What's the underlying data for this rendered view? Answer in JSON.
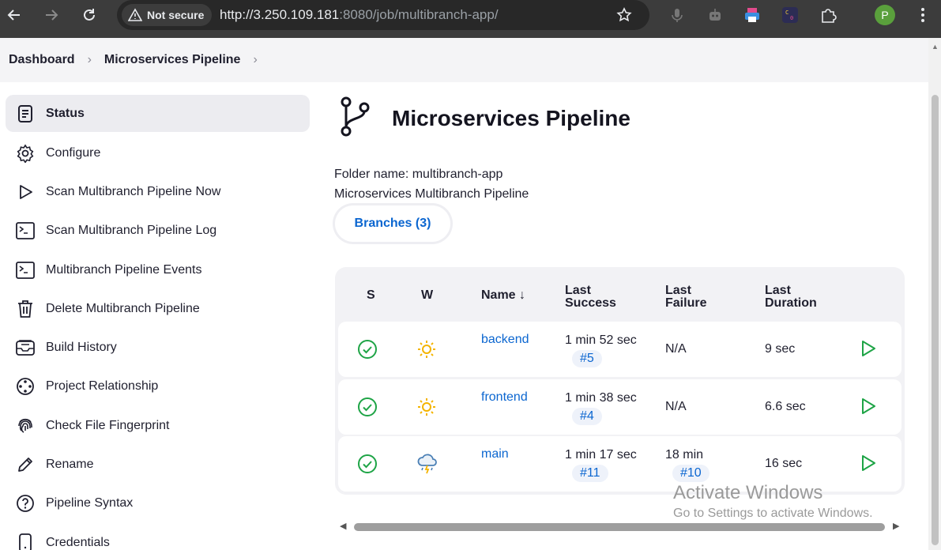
{
  "browser": {
    "security_label": "Not secure",
    "url_host": "http://3.250.109.181",
    "url_rest": ":8080/job/multibranch-app/",
    "profile_initial": "P"
  },
  "breadcrumb": {
    "items": [
      "Dashboard",
      "Microservices Pipeline"
    ]
  },
  "sidebar": {
    "items": [
      {
        "label": "Status",
        "icon": "document-icon"
      },
      {
        "label": "Configure",
        "icon": "gear-icon"
      },
      {
        "label": "Scan Multibranch Pipeline Now",
        "icon": "play-icon"
      },
      {
        "label": "Scan Multibranch Pipeline Log",
        "icon": "terminal-icon"
      },
      {
        "label": "Multibranch Pipeline Events",
        "icon": "terminal-icon"
      },
      {
        "label": "Delete Multibranch Pipeline",
        "icon": "trash-icon"
      },
      {
        "label": "Build History",
        "icon": "inbox-icon"
      },
      {
        "label": "Project Relationship",
        "icon": "relationship-icon"
      },
      {
        "label": "Check File Fingerprint",
        "icon": "fingerprint-icon"
      },
      {
        "label": "Rename",
        "icon": "pencil-icon"
      },
      {
        "label": "Pipeline Syntax",
        "icon": "help-icon"
      },
      {
        "label": "Credentials",
        "icon": "phone-icon"
      }
    ]
  },
  "main": {
    "title": "Microservices Pipeline",
    "folder_name": "Folder name: multibranch-app",
    "description": "Microservices Multibranch Pipeline",
    "tab_label": "Branches (3)"
  },
  "table": {
    "headers": {
      "s": "S",
      "w": "W",
      "name": "Name ↓",
      "last_success_1": "Last",
      "last_success_2": "Success",
      "last_failure_1": "Last",
      "last_failure_2": "Failure",
      "last_duration_1": "Last",
      "last_duration_2": "Duration"
    },
    "rows": [
      {
        "name": "backend",
        "weather": "sunny-icon",
        "last_success": "1 min 52 sec",
        "success_build": "#5",
        "last_failure": "N/A",
        "failure_build": "",
        "duration": "9 sec"
      },
      {
        "name": "frontend",
        "weather": "sunny-icon",
        "last_success": "1 min 38 sec",
        "success_build": "#4",
        "last_failure": "N/A",
        "failure_build": "",
        "duration": "6.6 sec"
      },
      {
        "name": "main",
        "weather": "storm-icon",
        "last_success": "1 min 17 sec",
        "success_build": "#11",
        "last_failure": "18 min",
        "failure_build": "#10",
        "duration": "16 sec"
      }
    ]
  },
  "watermark": {
    "line1": "Activate Windows",
    "line2": "Go to Settings to activate Windows."
  },
  "colors": {
    "link": "#0b66d0",
    "success": "#1ea446",
    "sun": "#f4b400"
  }
}
